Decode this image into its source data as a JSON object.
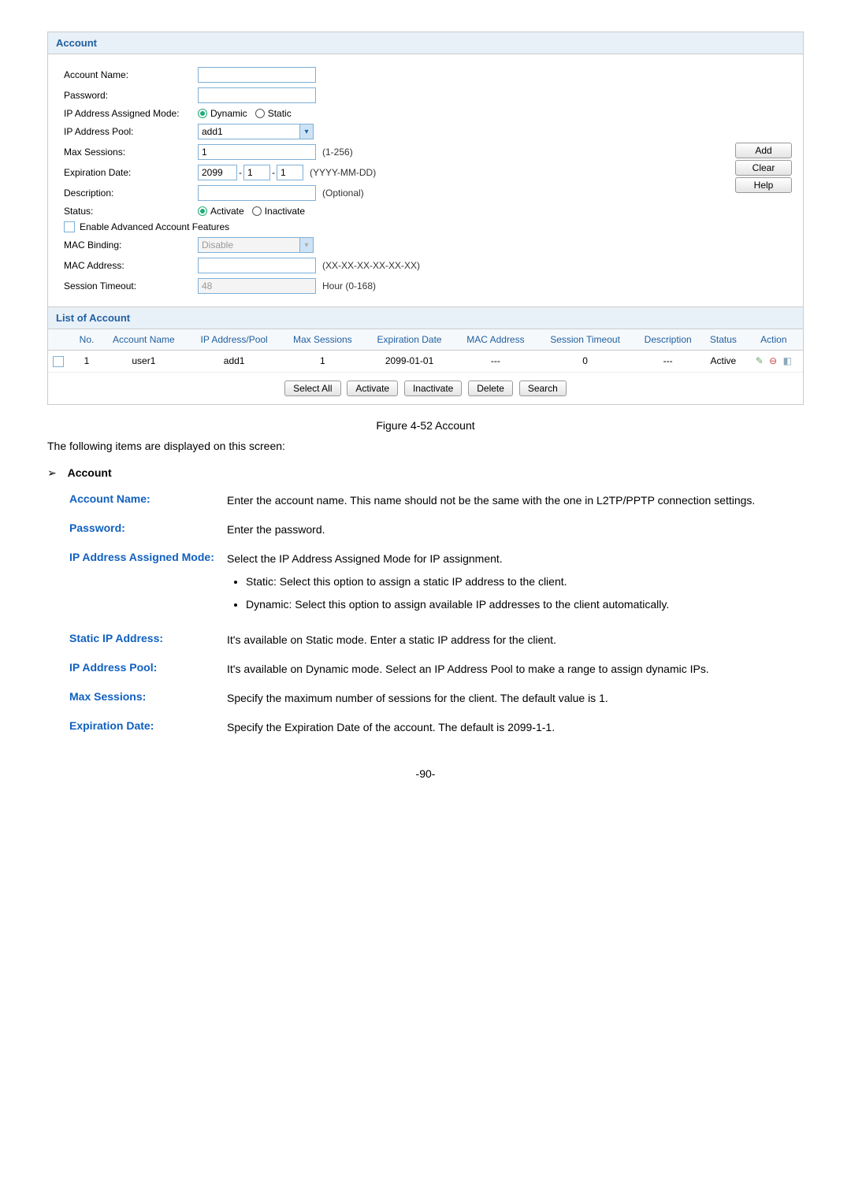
{
  "panel": {
    "title": "Account",
    "form": {
      "account_name_label": "Account Name:",
      "password_label": "Password:",
      "ip_mode_label": "IP Address Assigned Mode:",
      "ip_mode_dynamic": "Dynamic",
      "ip_mode_static": "Static",
      "ip_pool_label": "IP Address Pool:",
      "ip_pool_value": "add1",
      "max_sessions_label": "Max Sessions:",
      "max_sessions_value": "1",
      "max_sessions_hint": "(1-256)",
      "expiration_label": "Expiration Date:",
      "exp_year": "2099",
      "exp_month": "1",
      "exp_day": "1",
      "expiration_hint": "(YYYY-MM-DD)",
      "description_label": "Description:",
      "description_hint": "(Optional)",
      "status_label": "Status:",
      "status_activate": "Activate",
      "status_inactivate": "Inactivate",
      "advanced_label": "Enable Advanced Account Features",
      "mac_binding_label": "MAC Binding:",
      "mac_binding_value": "Disable",
      "mac_address_label": "MAC Address:",
      "mac_address_hint": "(XX-XX-XX-XX-XX-XX)",
      "session_timeout_label": "Session Timeout:",
      "session_timeout_value": "48",
      "session_timeout_hint": "Hour (0-168)"
    },
    "buttons": {
      "add": "Add",
      "clear": "Clear",
      "help": "Help"
    },
    "list_title": "List of Account",
    "columns": {
      "no": "No.",
      "account_name": "Account Name",
      "ip_pool": "IP Address/Pool",
      "max_sessions": "Max Sessions",
      "exp_date": "Expiration Date",
      "mac": "MAC Address",
      "sess_timeout": "Session Timeout",
      "desc": "Description",
      "status": "Status",
      "action": "Action"
    },
    "row": {
      "no": "1",
      "account_name": "user1",
      "ip_pool": "add1",
      "max_sessions": "1",
      "exp_date": "2099-01-01",
      "mac": "---",
      "sess_timeout": "0",
      "desc": "---",
      "status": "Active"
    },
    "bottom": {
      "select_all": "Select All",
      "activate": "Activate",
      "inactivate": "Inactivate",
      "delete": "Delete",
      "search": "Search"
    }
  },
  "figure_caption": "Figure 4-52 Account",
  "intro": "The following items are displayed on this screen:",
  "section_head": "Account",
  "defs": {
    "account_name": {
      "term": "Account Name:",
      "desc": "Enter the account name. This name should not be the same with the one in L2TP/PPTP connection settings."
    },
    "password": {
      "term": "Password:",
      "desc": "Enter the password."
    },
    "ip_mode": {
      "term": "IP Address Assigned Mode:",
      "lead": "Select the IP Address Assigned Mode for IP assignment.",
      "b1": "Static: Select this option to assign a static IP address to the client.",
      "b2": "Dynamic: Select this option to assign available IP addresses to the client automatically."
    },
    "static_ip": {
      "term": "Static IP Address:",
      "desc": "It's available on Static mode. Enter a static IP address for the client."
    },
    "ip_pool": {
      "term": "IP Address Pool:",
      "desc": "It's available on Dynamic mode. Select an IP Address Pool to make a range to assign dynamic IPs."
    },
    "max_sessions": {
      "term": "Max Sessions:",
      "desc": "Specify the maximum number of sessions for the client. The default value is 1."
    },
    "expiration": {
      "term": "Expiration Date:",
      "desc": "Specify the Expiration Date of the account. The default is 2099-1-1."
    }
  },
  "pagenum": "-90-"
}
